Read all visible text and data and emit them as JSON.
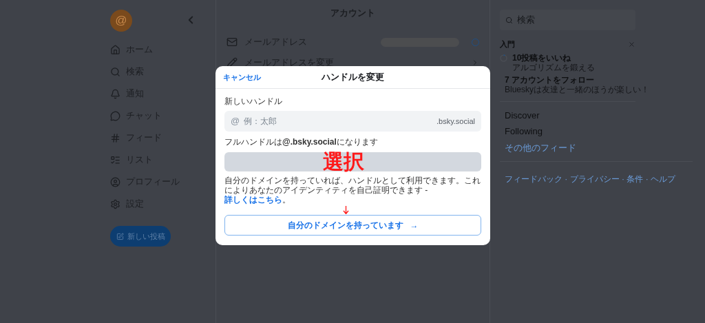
{
  "sidebar": {
    "avatar": "@",
    "nav": [
      {
        "kind": "home",
        "label": "ホーム"
      },
      {
        "kind": "search",
        "label": "検索"
      },
      {
        "kind": "bell",
        "label": "通知"
      },
      {
        "kind": "chat",
        "label": "チャット"
      },
      {
        "kind": "hash",
        "label": "フィード"
      },
      {
        "kind": "list",
        "label": "リスト"
      },
      {
        "kind": "user",
        "label": "プロフィール"
      },
      {
        "kind": "gear",
        "label": "設定"
      }
    ],
    "compose": "新しい投稿"
  },
  "main": {
    "title": "アカウント",
    "rows": [
      {
        "kind": "mail",
        "label": "メールアドレス"
      },
      {
        "kind": "pencil",
        "label": "メールアドレスを変更"
      }
    ]
  },
  "right": {
    "search": {
      "placeholder": "検索"
    },
    "getting_started": {
      "title": "入門",
      "tasks": [
        {
          "title": "10投稿をいいね",
          "subtitle": "アルゴリズムを鍛える"
        },
        {
          "title": "7 アカウントをフォロー",
          "subtitle": "Blueskyは友達と一緒のほうが楽しい！"
        }
      ]
    },
    "feeds": [
      "Discover",
      "Following"
    ],
    "more_feeds": "その他のフィード",
    "footer": "フィードバック · プライバシー · 条件 · ヘルプ"
  },
  "dialog": {
    "cancel": "キャンセル",
    "title": "ハンドルを変更",
    "field_label": "新しいハンドル",
    "prefix": "@",
    "placeholder": "例：太郎",
    "suffix": ".bsky.social",
    "note": "フルハンドルは**@.bsky.social**になります",
    "info": "自分のドメインを持っていれば、ハンドルとして利用できます。これによりあなたのアイデンティティを自己証明できます - ",
    "learn_more": "詳しくはこちら",
    "info_end": "。",
    "domain_button": "自分のドメインを持っています",
    "domain_arrow": "→"
  },
  "annotation": {
    "label": "選択"
  }
}
